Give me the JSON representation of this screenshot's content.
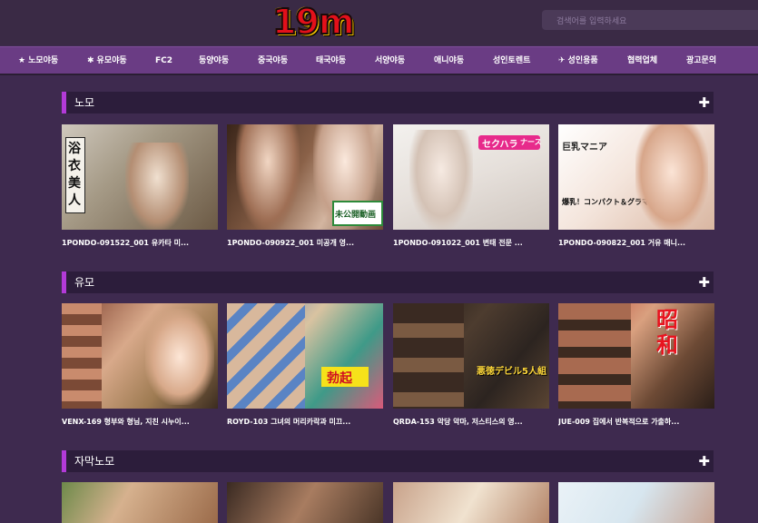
{
  "header": {
    "logo_text": "19m",
    "search_placeholder": "검색어를 입력하세요"
  },
  "nav": [
    {
      "label": "노모야동",
      "icon": "star-icon"
    },
    {
      "label": "유모야동",
      "icon": "gear-icon"
    },
    {
      "label": "FC2"
    },
    {
      "label": "동양야동"
    },
    {
      "label": "중국야동"
    },
    {
      "label": "태국야동"
    },
    {
      "label": "서양야동"
    },
    {
      "label": "애니야동"
    },
    {
      "label": "성인토렌트"
    },
    {
      "label": "성인용품",
      "icon": "toy-icon"
    },
    {
      "label": "협력업체"
    },
    {
      "label": "광고문의"
    }
  ],
  "sections": [
    {
      "title": "노모",
      "items": [
        {
          "caption": "1PONDO-091522_001 유카타 미..."
        },
        {
          "caption": "1PONDO-090922_001 미공개 영..."
        },
        {
          "caption": "1PONDO-091022_001 변태 전문 ..."
        },
        {
          "caption": "1PONDO-090822_001 거유 매니..."
        }
      ]
    },
    {
      "title": "유모",
      "items": [
        {
          "caption": "VENX-169 형부와 형님, 지친 시누이..."
        },
        {
          "caption": "ROYD-103 그녀의 머리카락과 미끄..."
        },
        {
          "caption": "QRDA-153 악당 악마, 저스티스의 영..."
        },
        {
          "caption": "JUE-009 집에서 반복적으로 가출하..."
        }
      ]
    },
    {
      "title": "자막노모",
      "items": [
        {},
        {},
        {},
        {}
      ]
    }
  ],
  "thumb_text": {
    "yukata": "浴衣美人",
    "unpublished": "未公開動画",
    "sekuhara": "セクハラ",
    "nurse": "ナース",
    "kyonyu": "巨乳マニア",
    "bakunyu": "爆乳！コンパクト＆グラマー",
    "akutoku": "悪徳デビル5人組",
    "showa": "昭和",
    "kaku": "勃起"
  },
  "colors": {
    "background": "#3e2a4f",
    "nav": "#6a3c84",
    "section_bar": "#2c1d3b",
    "accent": "#b23ad8",
    "logo_red": "#e3101a",
    "logo_yellow": "#f0c000"
  }
}
